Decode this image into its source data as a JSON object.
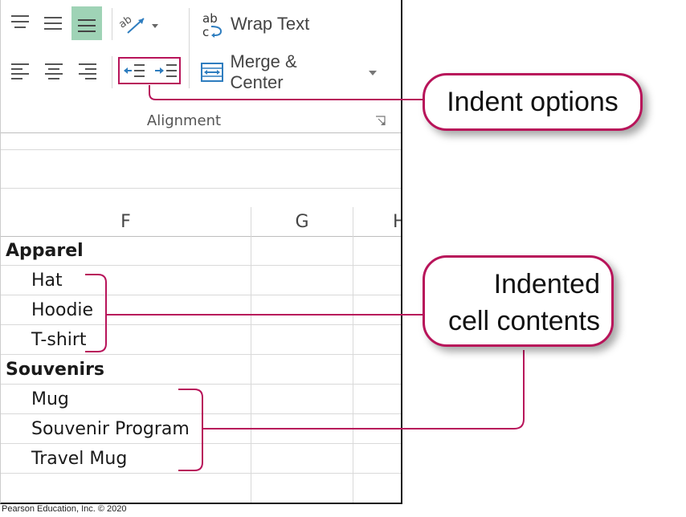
{
  "ribbon": {
    "wrap_text_label": "Wrap Text",
    "merge_center_label": "Merge & Center",
    "group_label": "Alignment",
    "colors": {
      "selected_bg": "#9fd3b6",
      "indent_highlight": "#b8145a",
      "icon_blue": "#2e7dbf"
    }
  },
  "columns": [
    "F",
    "G",
    "H"
  ],
  "rows": [
    {
      "text": "Apparel",
      "bold": true
    },
    {
      "text": "Hat",
      "indented": true
    },
    {
      "text": "Hoodie",
      "indented": true
    },
    {
      "text": "T-shirt",
      "indented": true
    },
    {
      "text": "Souvenirs",
      "bold": true
    },
    {
      "text": "Mug",
      "indented": true
    },
    {
      "text": "Souvenir Program",
      "indented": true
    },
    {
      "text": "Travel Mug",
      "indented": true
    }
  ],
  "callouts": {
    "indent_options": "Indent options",
    "indented_line1": "Indented",
    "indented_line2": "cell contents",
    "border_color": "#b8145a"
  },
  "footer": "Pearson Education, Inc. © 2020"
}
